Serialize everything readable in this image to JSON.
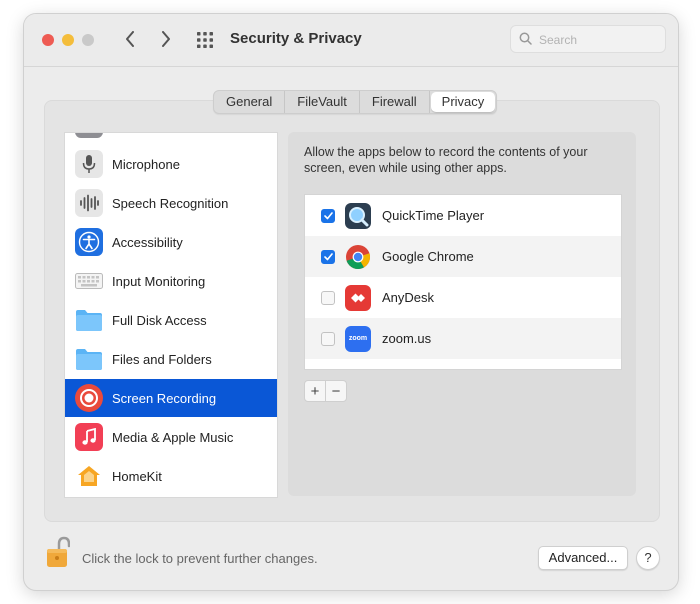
{
  "window": {
    "title": "Security & Privacy",
    "search_placeholder": "Search"
  },
  "tabs": [
    {
      "label": "General",
      "active": false
    },
    {
      "label": "FileVault",
      "active": false
    },
    {
      "label": "Firewall",
      "active": false
    },
    {
      "label": "Privacy",
      "active": true
    }
  ],
  "sidebar": {
    "items": [
      {
        "label": "Microphone",
        "icon": "microphone-icon",
        "selected": false
      },
      {
        "label": "Speech Recognition",
        "icon": "waveform-icon",
        "selected": false
      },
      {
        "label": "Accessibility",
        "icon": "accessibility-icon",
        "selected": false
      },
      {
        "label": "Input Monitoring",
        "icon": "keyboard-icon",
        "selected": false
      },
      {
        "label": "Full Disk Access",
        "icon": "folder-icon",
        "selected": false
      },
      {
        "label": "Files and Folders",
        "icon": "folder-icon",
        "selected": false
      },
      {
        "label": "Screen Recording",
        "icon": "screen-recording-icon",
        "selected": true
      },
      {
        "label": "Media & Apple Music",
        "icon": "music-icon",
        "selected": false
      },
      {
        "label": "HomeKit",
        "icon": "home-icon",
        "selected": false
      }
    ]
  },
  "content": {
    "description": "Allow the apps below to record the contents of your screen, even while using other apps.",
    "apps": [
      {
        "name": "QuickTime Player",
        "checked": true,
        "icon": "quicktime-icon"
      },
      {
        "name": "Google Chrome",
        "checked": true,
        "icon": "chrome-icon"
      },
      {
        "name": "AnyDesk",
        "checked": false,
        "icon": "anydesk-icon"
      },
      {
        "name": "zoom.us",
        "checked": false,
        "icon": "zoom-icon",
        "icon_text": "zoom"
      }
    ],
    "add_label": "+",
    "remove_label": "−"
  },
  "footer": {
    "lock_text": "Click the lock to prevent further changes.",
    "advanced_label": "Advanced...",
    "help_label": "?"
  },
  "colors": {
    "selection": "#0a57d6",
    "checkbox_on": "#1a73e8",
    "close": "#ee5b53",
    "minimize": "#f4bd3b"
  }
}
